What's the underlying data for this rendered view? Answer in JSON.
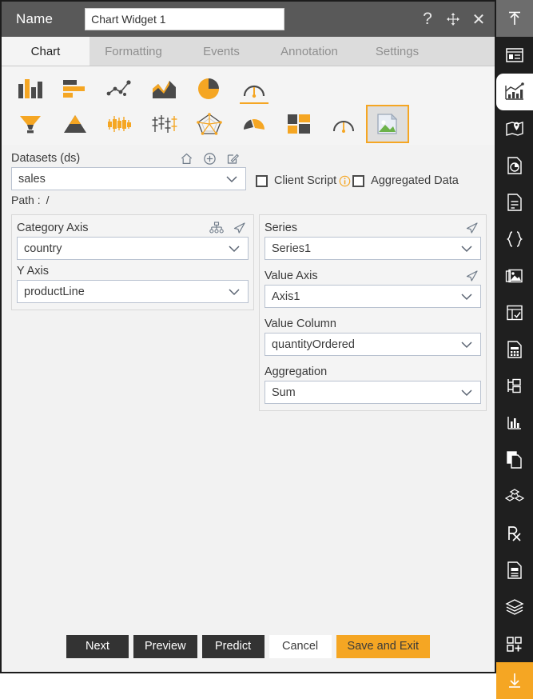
{
  "titlebar": {
    "name_label": "Name",
    "widget_name": "Chart Widget 1",
    "name_placeholder": "Chart Widget 1",
    "help_icon": "question-mark-icon",
    "move_icon": "move-icon",
    "close_icon": "close-icon"
  },
  "tabs": [
    {
      "label": "Chart",
      "active": true
    },
    {
      "label": "Formatting",
      "active": false
    },
    {
      "label": "Events",
      "active": false
    },
    {
      "label": "Annotation",
      "active": false
    },
    {
      "label": "Settings",
      "active": false
    }
  ],
  "chart_types": {
    "row1": [
      {
        "name": "column-chart-icon",
        "state": "normal"
      },
      {
        "name": "bar-chart-icon",
        "state": "normal"
      },
      {
        "name": "scatter-line-chart-icon",
        "state": "normal"
      },
      {
        "name": "area-chart-icon",
        "state": "normal"
      },
      {
        "name": "pie-chart-icon",
        "state": "normal"
      },
      {
        "name": "gauge-chart-icon",
        "state": "underlined"
      }
    ],
    "row2": [
      {
        "name": "funnel-chart-icon",
        "state": "normal"
      },
      {
        "name": "pyramid-chart-icon",
        "state": "normal"
      },
      {
        "name": "candlestick-chart-icon",
        "state": "normal"
      },
      {
        "name": "boxplot-chart-icon",
        "state": "normal"
      },
      {
        "name": "radar-chart-icon",
        "state": "normal"
      },
      {
        "name": "semi-gauge-chart-icon",
        "state": "normal"
      },
      {
        "name": "treemap-chart-icon",
        "state": "normal"
      },
      {
        "name": "dial-gauge-chart-icon",
        "state": "normal"
      },
      {
        "name": "image-widget-icon",
        "state": "selected"
      }
    ]
  },
  "datasets": {
    "label": "Datasets (ds)",
    "home_icon": "home-icon",
    "add_icon": "plus-circle-icon",
    "edit_icon": "edit-pencil-icon",
    "value": "sales",
    "path_label": "Path :",
    "path_value": "/"
  },
  "options": {
    "client_script_label": "Client Script",
    "client_script_checked": false,
    "info_icon": "info-circle-icon",
    "aggregated_data_label": "Aggregated Data",
    "aggregated_data_checked": false
  },
  "left_fields": [
    {
      "label": "Category Axis",
      "value": "country",
      "icons": [
        "hierarchy-icon",
        "send-arrow-icon"
      ]
    },
    {
      "label": "Y Axis",
      "value": "productLine",
      "icons": []
    }
  ],
  "right_fields": [
    {
      "label": "Series",
      "value": "Series1",
      "icons": [
        "send-arrow-icon"
      ]
    },
    {
      "label": "Value Axis",
      "value": "Axis1",
      "icons": [
        "send-arrow-icon"
      ]
    },
    {
      "label": "Value Column",
      "value": "quantityOrdered",
      "icons": []
    },
    {
      "label": "Aggregation",
      "value": "Sum",
      "icons": []
    }
  ],
  "footer_buttons": [
    {
      "label": "Next",
      "style": "dark"
    },
    {
      "label": "Preview",
      "style": "dark"
    },
    {
      "label": "Predict",
      "style": "dark"
    },
    {
      "label": "Cancel",
      "style": "light"
    },
    {
      "label": "Save and Exit",
      "style": "accent"
    }
  ],
  "rail": [
    {
      "name": "collapse-up-icon",
      "state": "top"
    },
    {
      "name": "form-layout-icon",
      "state": "normal"
    },
    {
      "name": "chart-widget-icon",
      "state": "active"
    },
    {
      "name": "map-widget-icon",
      "state": "normal"
    },
    {
      "name": "report-pie-icon",
      "state": "normal"
    },
    {
      "name": "document-icon",
      "state": "normal"
    },
    {
      "name": "code-braces-icon",
      "state": "normal"
    },
    {
      "name": "gallery-image-icon",
      "state": "normal"
    },
    {
      "name": "grid-table-icon",
      "state": "normal"
    },
    {
      "name": "data-sheet-icon",
      "state": "normal"
    },
    {
      "name": "tree-structure-icon",
      "state": "normal"
    },
    {
      "name": "bar-stat-icon",
      "state": "normal"
    },
    {
      "name": "copy-page-icon",
      "state": "normal"
    },
    {
      "name": "cube-group-icon",
      "state": "normal"
    },
    {
      "name": "prescription-rx-icon",
      "state": "normal"
    },
    {
      "name": "note-document-icon",
      "state": "normal"
    },
    {
      "name": "layers-icon",
      "state": "normal"
    },
    {
      "name": "add-widget-icon",
      "state": "normal"
    },
    {
      "name": "expand-down-icon",
      "state": "bottom"
    }
  ],
  "colors": {
    "accent": "#f5a623",
    "titlebar": "#595959",
    "rail": "#1f1f1f",
    "panel": "#f4f4f4",
    "dark_button": "#333333"
  }
}
